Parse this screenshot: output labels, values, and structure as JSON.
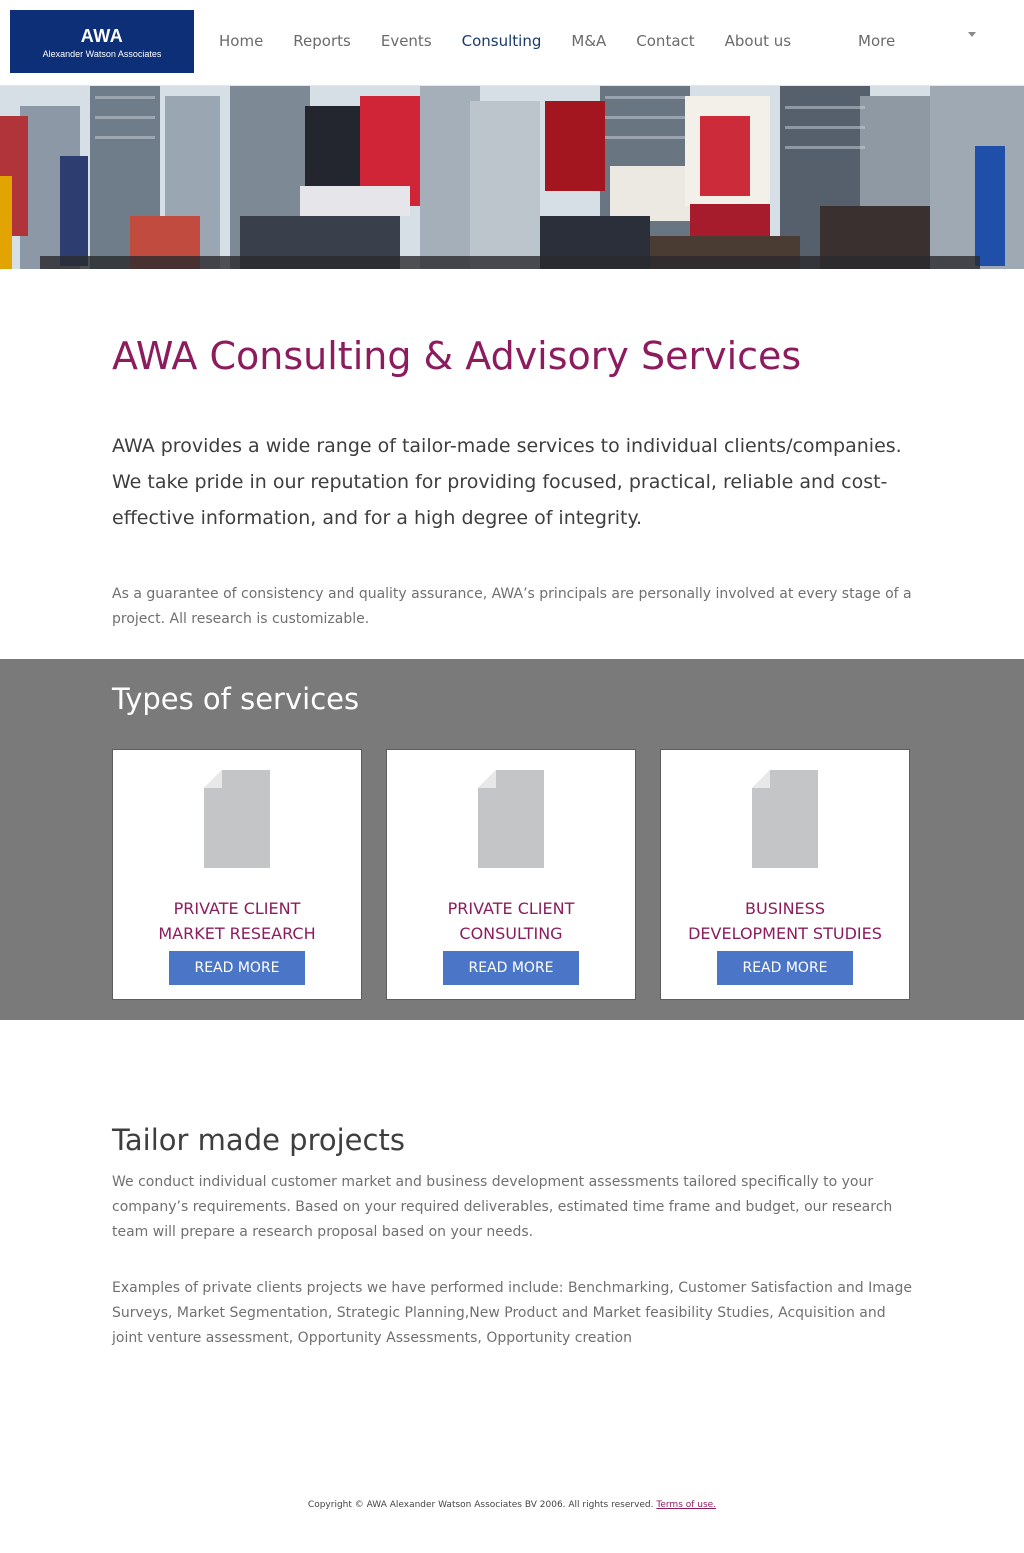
{
  "header": {
    "logo_title": "AWA",
    "logo_subtitle": "Alexander Watson Associates",
    "nav": [
      "Home",
      "Reports",
      "Events",
      "Consulting",
      "M&A",
      "Contact",
      "About us"
    ],
    "active_nav": "Consulting",
    "more_label": "More"
  },
  "intro": {
    "title": "AWA Consulting & Advisory Services",
    "lead": "AWA provides a wide range of tailor-made services to individual clients/companies. We take pride in our reputation for providing focused, practical, reliable and cost-effective information, and for a high degree of integrity.",
    "note": "As a guarantee of consistency and quality assurance, AWA’s principals are personally involved at every stage of a project. All research is customizable."
  },
  "services": {
    "title": "Types of services",
    "cards": [
      {
        "line1": "PRIVATE CLIENT",
        "line2": "MARKET RESEARCH",
        "button": "READ MORE"
      },
      {
        "line1": "PRIVATE CLIENT",
        "line2": "CONSULTING",
        "button": "READ MORE"
      },
      {
        "line1": "BUSINESS",
        "line2": "DEVELOPMENT STUDIES",
        "button": "READ MORE"
      }
    ]
  },
  "tailor": {
    "title": "Tailor made projects",
    "p1": "We conduct individual customer market and business development assessments tailored specifically to your company’s requirements. Based on your required deliverables, estimated time frame and budget, our research team will prepare a research proposal based on your needs.",
    "p2": "Examples of private clients projects we have performed include: Benchmarking, Customer Satisfaction and Image Surveys, Market Segmentation, Strategic Planning,New Product and Market feasibility Studies, Acquisition and joint venture assessment, Opportunity Assessments, Opportunity creation"
  },
  "footer": {
    "copyright": "Copyright © AWA Alexander Watson Associates BV 2006. All rights reserved. ",
    "terms_link": "Terms of use."
  },
  "colors": {
    "brand_navy": "#0d2f78",
    "accent_plum": "#8c1c5e",
    "button_blue": "#4b76c7",
    "band_gray": "#7a7a7a"
  }
}
